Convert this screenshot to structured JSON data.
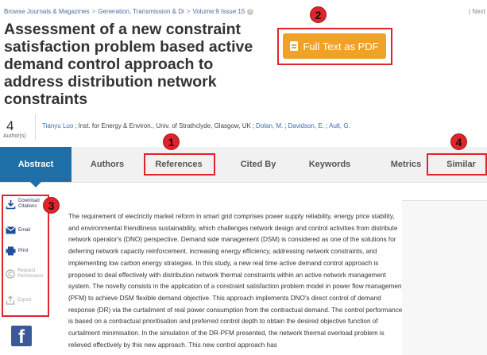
{
  "breadcrumb": {
    "items": [
      "Browse Journals & Magazines",
      "Generation, Transmission & Di",
      "Volume:9 Issue:15"
    ],
    "separator": ">",
    "help": "?"
  },
  "next_link": "Next",
  "article": {
    "title": "Assessment of a new constraint satisfaction problem based active demand control approach to address distribution network constraints"
  },
  "pdf_button": {
    "label": "Full Text as PDF",
    "color": "#f0a227"
  },
  "callouts": {
    "c1": "1",
    "c2": "2",
    "c3": "3",
    "c4": "4",
    "color": "#e0242b"
  },
  "authors": {
    "count": "4",
    "count_label": "Author(s)",
    "primary": "Tianyu Luo",
    "affiliation": "Inst. for Energy & Environ., Univ. of Strathclyde, Glasgow, UK",
    "others": [
      "Dolan, M.",
      "Davidson, E.",
      "Ault, G."
    ]
  },
  "tabs": [
    {
      "label": "Abstract",
      "active": true
    },
    {
      "label": "Authors"
    },
    {
      "label": "References"
    },
    {
      "label": "Cited By"
    },
    {
      "label": "Keywords"
    },
    {
      "label": "Metrics"
    },
    {
      "label": "Similar"
    }
  ],
  "sidebar": {
    "download": "Download Citations",
    "email": "Email",
    "print": "Print",
    "request": "Request Permissions",
    "export": "Export",
    "facebook": "f"
  },
  "abstract": {
    "text": "The requirement of electricity market reform in smart grid comprises power supply reliability, energy price stability, and environmental friendliness sustainability, which challenges network design and control activities from distribute network operator's (DNO) perspective. Demand side management (DSM) is considered as one of the solutions for deferring network capacity reinforcement, increasing energy efficiency, addressing network constraints, and implementing low carbon energy strategies. In this study, a new real time active demand control approach is proposed to deal effectively with distribution network thermal constraints within an active network management system. The novelty consists in the application of a constraint satisfaction problem model in power flow management (PFM) to achieve DSM flexible demand objective. This approach implements DNO's direct control of demand response (DR) via the curtailment of real power consumption from the contractual demand. The control performance is based on a contractual prioritisation and preferred control depth to obtain the desired objective function of curtailment minimisation. In the simulation of the DR-PFM presented, the network thermal overload problem is relieved effectively by this new approach. This new control approach has"
  }
}
